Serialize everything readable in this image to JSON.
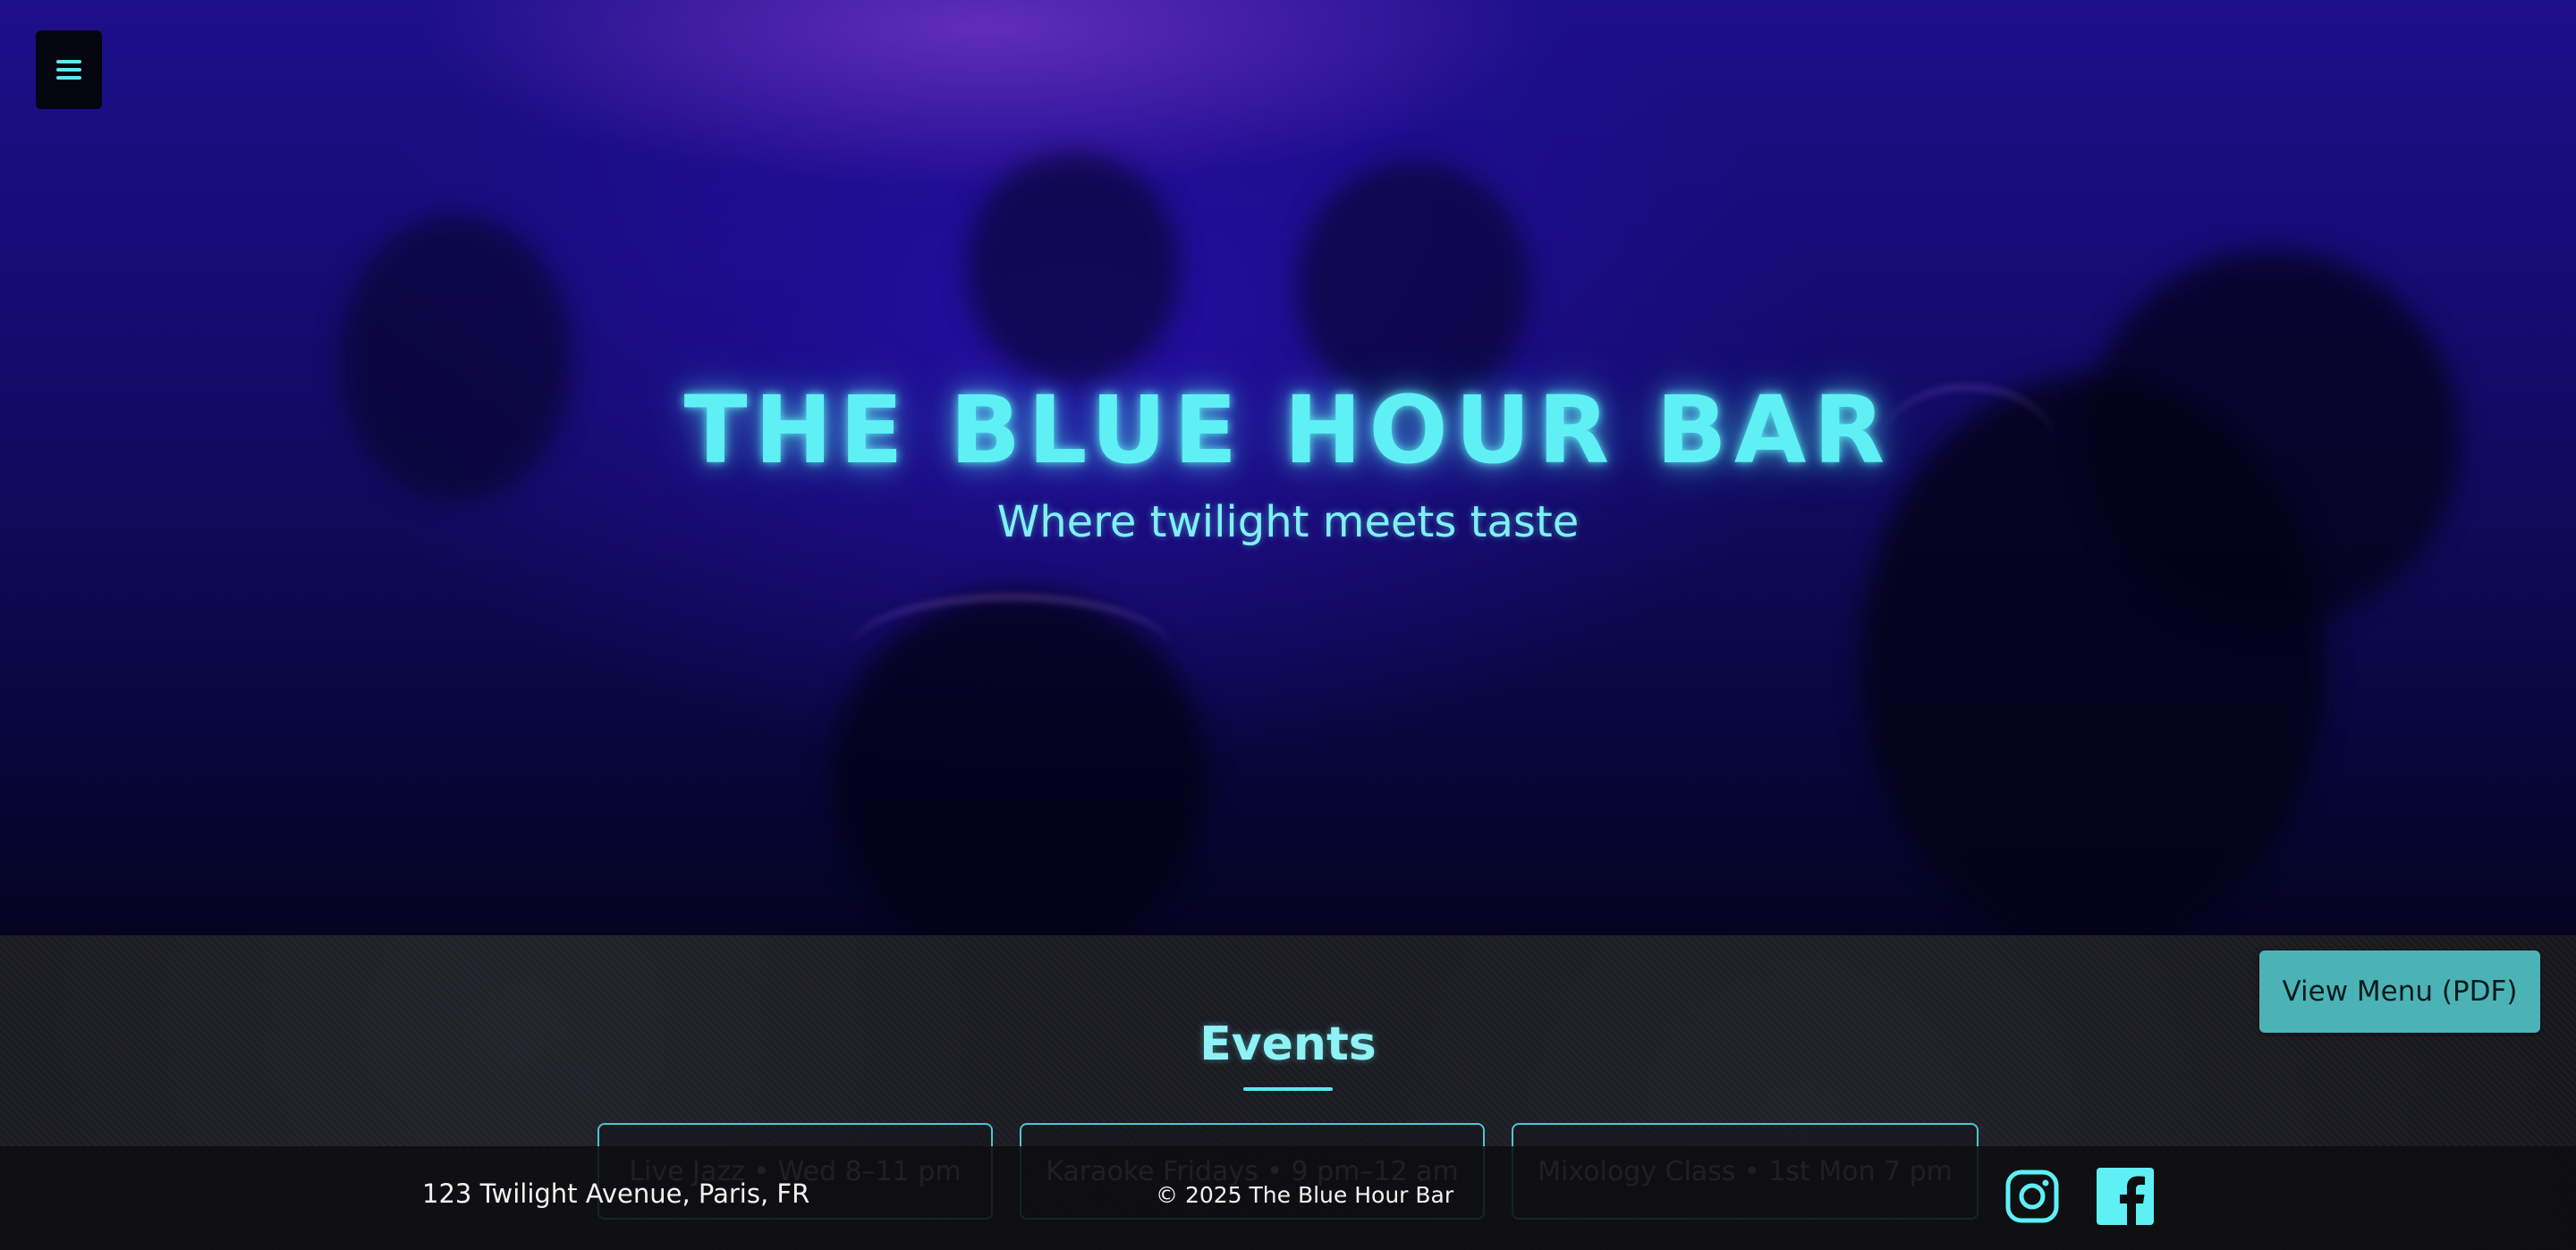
{
  "hero": {
    "title": "THE BLUE HOUR BAR",
    "subtitle": "Where twilight meets taste"
  },
  "nav": {
    "menu_icon": "hamburger-menu-icon"
  },
  "events": {
    "heading": "Events",
    "items": [
      {
        "label": "Live Jazz • Wed 8–11 pm"
      },
      {
        "label": "Karaoke Fridays • 9 pm–12 am"
      },
      {
        "label": "Mixology Class • 1st Mon 7 pm"
      }
    ]
  },
  "actions": {
    "view_menu_label": "View Menu (PDF)"
  },
  "footer": {
    "address": "123 Twilight Avenue, Paris, FR",
    "copyright": "© 2025 The Blue Hour Bar",
    "social_icons": [
      "instagram-icon",
      "facebook-icon"
    ]
  },
  "colors": {
    "accent": "#5ef0f5",
    "button": "#4bb3b6",
    "hero_bg": "#160c78",
    "footer_bg": "#0e0e10"
  }
}
